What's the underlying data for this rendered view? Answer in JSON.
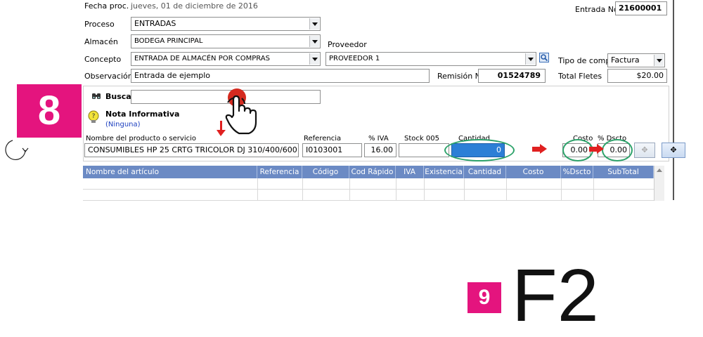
{
  "header": {
    "fecha_label": "Fecha proc.",
    "fecha_value": "jueves, 01 de diciembre de 2016",
    "entrada_label": "Entrada No",
    "entrada_value": "21600001"
  },
  "form": {
    "proceso_label": "Proceso",
    "proceso_value": "ENTRADAS",
    "almacen_label": "Almacén",
    "almacen_value": "BODEGA PRINCIPAL",
    "proveedor_label": "Proveedor",
    "concepto_label": "Concepto",
    "concepto_value": "ENTRADA DE ALMACÉN POR COMPRAS",
    "proveedor_value": "PROVEEDOR 1",
    "tipo_compra_label": "Tipo de compra",
    "tipo_compra_value": "Factura",
    "observacion_label": "Observación",
    "observacion_value": "Entrada de ejemplo",
    "remision_label": "Remisión No",
    "remision_value": "01524789",
    "total_fletes_label": "Total Fletes",
    "total_fletes_value": "$20.00"
  },
  "search": {
    "label": "Buscar",
    "value": ""
  },
  "nota": {
    "title": "Nota Informativa",
    "value": "(Ninguna)"
  },
  "product_entry": {
    "nombre_label": "Nombre del producto o servicio",
    "nombre_value": "CONSUMIBLES HP 25 CRTG TRICOLOR DJ 310/400/600",
    "referencia_label": "Referencia",
    "referencia_value": "I0103001",
    "iva_label": "% IVA",
    "iva_value": "16.00",
    "stock_label": "Stock 005",
    "stock_value": "",
    "cantidad_label": "Cantidad",
    "cantidad_value": "0",
    "costo_label": "Costo",
    "costo_value": "0.00",
    "dscto_label": "% Dscto",
    "dscto_value": "0.00"
  },
  "grid": {
    "columns": [
      "Nombre del artículo",
      "Referencia",
      "Código",
      "Cod Rápido",
      "IVA",
      "Existencia",
      "Cantidad",
      "Costo",
      "%Dscto",
      "SubTotal"
    ]
  },
  "steps": {
    "step8": "8",
    "step9": "9",
    "key": "F2"
  },
  "colors": {
    "step_badge": "#e4147e",
    "grid_header": "#6b8ac4",
    "highlight": "#2c7fd6",
    "annotation_red": "#e02020",
    "annotation_green": "#2ea36b"
  }
}
